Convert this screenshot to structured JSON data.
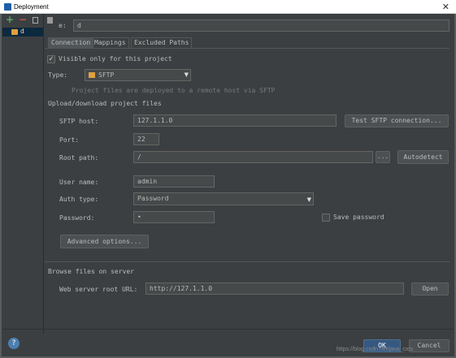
{
  "window": {
    "title": "Deployment",
    "close_glyph": "✕"
  },
  "toolbar": {
    "add_glyph": "+",
    "remove_glyph": "−",
    "copy_icon": "copy-icon",
    "default_icon": "set-default-icon"
  },
  "server_list": {
    "items": [
      {
        "name": "d",
        "icon": "sftp-server-icon"
      }
    ]
  },
  "name": {
    "label": "e:",
    "value": "d"
  },
  "tabs": [
    {
      "label": "Connection",
      "active": true
    },
    {
      "label": "Mappings",
      "active": false
    },
    {
      "label": "Excluded Paths",
      "active": false
    }
  ],
  "visible_only": {
    "label": "Visible only for this project",
    "checked": true
  },
  "type": {
    "label": "Type:",
    "value": "SFTP",
    "hint": "Project files are deployed to a remote host via SFTP"
  },
  "upload_section": {
    "title": "Upload/download project files"
  },
  "sftp_host": {
    "label": "SFTP host:",
    "value": "127.1.1.0",
    "test_button": "Test SFTP connection..."
  },
  "port": {
    "label": "Port:",
    "value": "22"
  },
  "root_path": {
    "label": "Root path:",
    "value": "/",
    "browse": "...",
    "autodetect": "Autodetect"
  },
  "user_name": {
    "label": "User name:",
    "value": "admin"
  },
  "auth_type": {
    "label": "Auth type:",
    "value": "Password"
  },
  "password": {
    "label": "Password:",
    "value": "•",
    "save_label": "Save password",
    "save_checked": false
  },
  "advanced": {
    "label": "Advanced options..."
  },
  "browse_section": {
    "title": "Browse files on server"
  },
  "web_root": {
    "label": "Web server root URL:",
    "value": "http://127.1.1.0",
    "open": "Open"
  },
  "footer": {
    "help": "?",
    "ok": "OK",
    "cancel": "Cancel",
    "watermark": "https://blog.csdn.net/java_cxrs"
  },
  "colors": {
    "background": "#3c3f41",
    "field": "#45494a",
    "accent": "#365880",
    "text": "#bbbbbb"
  }
}
